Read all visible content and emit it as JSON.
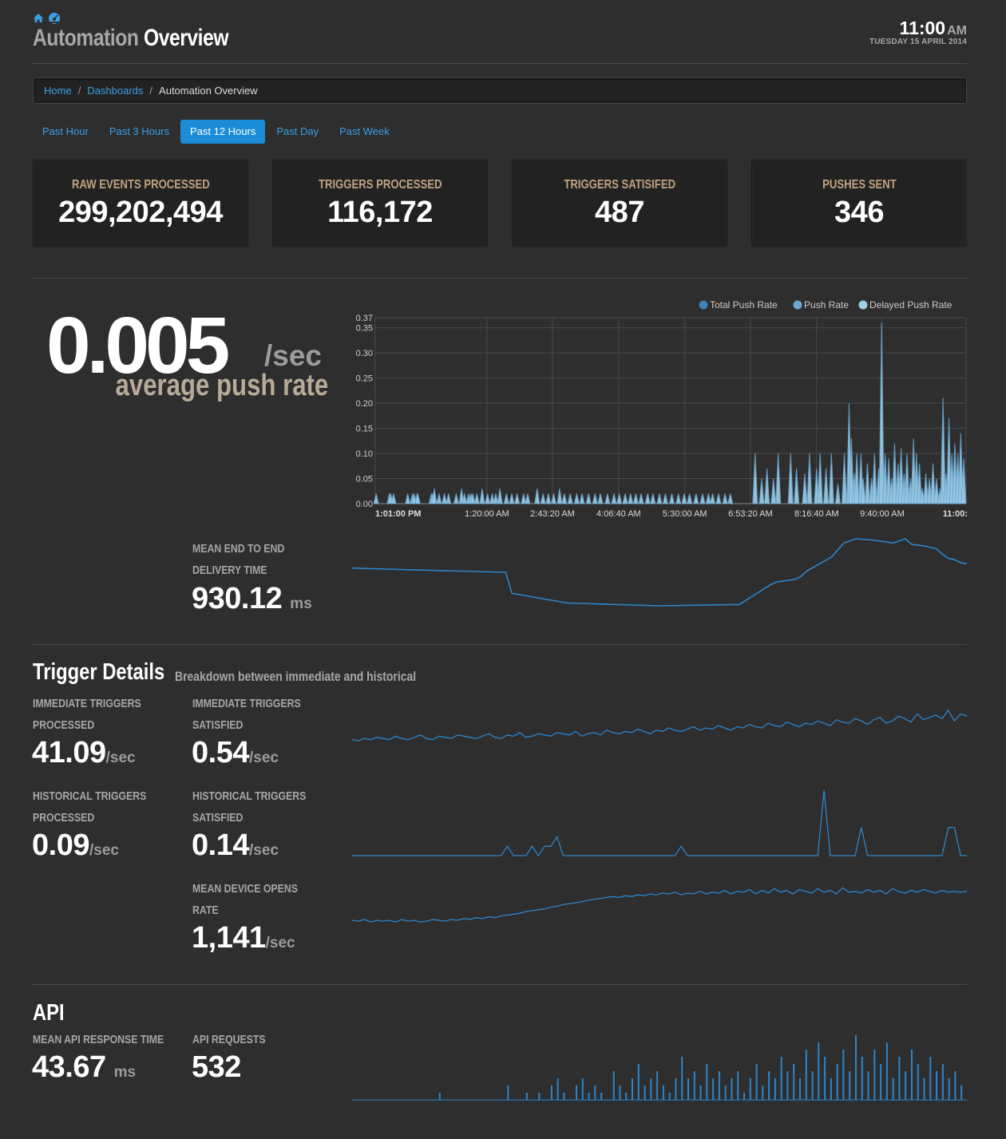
{
  "header": {
    "title_part1": "Automation",
    "title_part2": "Overview",
    "time": "11:00",
    "ampm": "AM",
    "date": "TUESDAY 15 APRIL 2014",
    "icons": [
      "home-icon",
      "dashboard-icon"
    ]
  },
  "breadcrumb": {
    "items": [
      "Home",
      "Dashboards"
    ],
    "current": "Automation Overview",
    "separator": "/"
  },
  "time_tabs": {
    "items": [
      "Past Hour",
      "Past 3 Hours",
      "Past 12 Hours",
      "Past Day",
      "Past Week"
    ],
    "active": "Past 12 Hours"
  },
  "stats": [
    {
      "label": "RAW EVENTS PROCESSED",
      "value": "299,202,494"
    },
    {
      "label": "TRIGGERS PROCESSED",
      "value": "116,172"
    },
    {
      "label": "TRIGGERS SATISIFED",
      "value": "487"
    },
    {
      "label": "PUSHES SENT",
      "value": "346"
    }
  ],
  "push_rate": {
    "value": "0.005",
    "unit": "/sec",
    "label": "average push rate"
  },
  "delivery": {
    "label_line1": "MEAN END TO END",
    "label_line2": "DELIVERY TIME",
    "value": "930.12",
    "unit": "ms"
  },
  "trigger_details": {
    "title": "Trigger Details",
    "subtitle": "Breakdown between immediate and historical",
    "metrics": [
      {
        "l1": "IMMEDIATE TRIGGERS",
        "l2": "PROCESSED",
        "value": "41.09",
        "unit": "/sec"
      },
      {
        "l1": "IMMEDIATE TRIGGERS",
        "l2": "SATISFIED",
        "value": "0.54",
        "unit": "/sec"
      },
      {
        "l1": "HISTORICAL TRIGGERS",
        "l2": "PROCESSED",
        "value": "0.09",
        "unit": "/sec"
      },
      {
        "l1": "HISTORICAL TRIGGERS",
        "l2": "SATISFIED",
        "value": "0.14",
        "unit": "/sec"
      },
      {
        "l1": "MEAN DEVICE OPENS",
        "l2": "RATE",
        "value": "1,141",
        "unit": "/sec"
      }
    ]
  },
  "api": {
    "title": "API",
    "response_label": "MEAN API RESPONSE TIME",
    "response_value": "43.67",
    "response_unit": "ms",
    "requests_label": "API REQUESTS",
    "requests_value": "532"
  },
  "colors": {
    "accent": "#1a8cd8",
    "link": "#3aa0e6",
    "stat_label": "#c3a27d",
    "series_total": "#3d82b8",
    "series_push": "#6aa8d4",
    "series_delayed": "#9fd0ea",
    "spark": "#2b86cc"
  },
  "chart_data": [
    {
      "type": "area",
      "title": "",
      "legend": "top-right",
      "grid": true,
      "series": [
        {
          "name": "Total Push Rate",
          "color": "#3d82b8"
        },
        {
          "name": "Push Rate",
          "color": "#6aa8d4"
        },
        {
          "name": "Delayed Push Rate",
          "color": "#9fd0ea"
        }
      ],
      "ylim": [
        0,
        0.37
      ],
      "y_ticks": [
        "0.00",
        "0.05",
        "0.10",
        "0.15",
        "0.20",
        "0.25",
        "0.30",
        "0.35",
        "0.37"
      ],
      "x_ticks": [
        "1:01:00 PM",
        "1:20:00 AM",
        "2:43:20 AM",
        "4:06:40 AM",
        "5:30:00 AM",
        "6:53:20 AM",
        "8:16:40 AM",
        "9:40:00 AM",
        "11:00:"
      ],
      "spikes": [
        [
          0.15,
          0.02
        ],
        [
          2.4,
          0.02
        ],
        [
          2.6,
          0.02
        ],
        [
          3.1,
          0.02
        ],
        [
          5.5,
          0.02
        ],
        [
          6.3,
          0.02
        ],
        [
          6.6,
          0.02
        ],
        [
          7.1,
          0.02
        ],
        [
          7.2,
          0.02
        ],
        [
          9.5,
          0.02
        ],
        [
          9.7,
          0.02
        ],
        [
          10.0,
          0.03
        ],
        [
          10.8,
          0.02
        ],
        [
          11.7,
          0.02
        ],
        [
          12.4,
          0.02
        ],
        [
          13.7,
          0.02
        ],
        [
          14.6,
          0.03
        ],
        [
          15.1,
          0.02
        ],
        [
          15.8,
          0.02
        ],
        [
          16.2,
          0.02
        ],
        [
          16.5,
          0.02
        ],
        [
          17.2,
          0.02
        ],
        [
          18.1,
          0.03
        ],
        [
          19.0,
          0.02
        ],
        [
          19.8,
          0.02
        ],
        [
          20.4,
          0.02
        ],
        [
          21.1,
          0.03
        ],
        [
          22.2,
          0.02
        ],
        [
          23.1,
          0.02
        ],
        [
          24.0,
          0.02
        ],
        [
          25.1,
          0.02
        ],
        [
          25.8,
          0.02
        ],
        [
          27.4,
          0.03
        ],
        [
          28.4,
          0.02
        ],
        [
          29.3,
          0.02
        ],
        [
          30.2,
          0.02
        ],
        [
          31.2,
          0.03
        ],
        [
          32.0,
          0.02
        ],
        [
          33.0,
          0.02
        ],
        [
          34.1,
          0.02
        ],
        [
          35.0,
          0.02
        ],
        [
          36.1,
          0.02
        ],
        [
          37.2,
          0.02
        ],
        [
          38.1,
          0.02
        ],
        [
          39.3,
          0.02
        ],
        [
          40.4,
          0.02
        ],
        [
          41.3,
          0.02
        ],
        [
          42.3,
          0.02
        ],
        [
          43.2,
          0.02
        ],
        [
          44.1,
          0.02
        ],
        [
          45.0,
          0.02
        ],
        [
          46.1,
          0.02
        ],
        [
          47.0,
          0.02
        ],
        [
          48.1,
          0.02
        ],
        [
          49.1,
          0.02
        ],
        [
          50.2,
          0.02
        ],
        [
          51.3,
          0.02
        ],
        [
          52.3,
          0.02
        ],
        [
          53.2,
          0.02
        ],
        [
          54.3,
          0.02
        ],
        [
          55.4,
          0.02
        ],
        [
          56.4,
          0.02
        ],
        [
          57.1,
          0.02
        ],
        [
          58.1,
          0.02
        ],
        [
          59.2,
          0.02
        ],
        [
          60.1,
          0.02
        ],
        [
          64.3,
          0.1
        ],
        [
          65.4,
          0.05
        ],
        [
          66.3,
          0.07
        ],
        [
          67.4,
          0.05
        ],
        [
          68.2,
          0.1
        ],
        [
          70.3,
          0.1
        ],
        [
          71.3,
          0.07
        ],
        [
          72.7,
          0.06
        ],
        [
          73.5,
          0.1
        ],
        [
          74.7,
          0.07
        ],
        [
          75.3,
          0.1
        ],
        [
          76.3,
          0.07
        ],
        [
          77.2,
          0.1
        ],
        [
          78.3,
          0.04
        ],
        [
          79.4,
          0.1
        ],
        [
          80.2,
          0.2
        ],
        [
          80.6,
          0.13
        ],
        [
          81.1,
          0.06
        ],
        [
          81.5,
          0.1
        ],
        [
          82.2,
          0.1
        ],
        [
          82.6,
          0.05
        ],
        [
          83.3,
          0.08
        ],
        [
          84.0,
          0.05
        ],
        [
          84.5,
          0.1
        ],
        [
          85.2,
          0.07
        ],
        [
          85.7,
          0.36
        ],
        [
          86.3,
          0.1
        ],
        [
          86.9,
          0.09
        ],
        [
          87.4,
          0.05
        ],
        [
          87.9,
          0.12
        ],
        [
          88.5,
          0.08
        ],
        [
          89.0,
          0.11
        ],
        [
          89.5,
          0.06
        ],
        [
          90.0,
          0.1
        ],
        [
          90.6,
          0.05
        ],
        [
          91.1,
          0.13
        ],
        [
          91.6,
          0.1
        ],
        [
          92.1,
          0.08
        ],
        [
          92.6,
          0.03
        ],
        [
          93.2,
          0.06
        ],
        [
          93.8,
          0.05
        ],
        [
          94.4,
          0.08
        ],
        [
          95.0,
          0.05
        ],
        [
          95.6,
          0.03
        ],
        [
          96.1,
          0.21
        ],
        [
          96.6,
          0.06
        ],
        [
          97.1,
          0.17
        ],
        [
          97.6,
          0.1
        ],
        [
          98.1,
          0.12
        ],
        [
          98.6,
          0.1
        ],
        [
          99.1,
          0.14
        ],
        [
          99.6,
          0.09
        ]
      ]
    },
    {
      "type": "line",
      "title": "",
      "x": [
        0,
        8,
        25,
        26,
        35,
        50,
        63,
        68,
        69,
        72,
        73,
        74,
        78,
        80,
        82,
        85,
        88,
        90,
        91,
        93,
        95,
        96,
        97,
        98,
        99,
        100
      ],
      "values": [
        930,
        929,
        927,
        912,
        905,
        903,
        904,
        918,
        920,
        922,
        924,
        928,
        938,
        948,
        951,
        950,
        948,
        951,
        947,
        946,
        944,
        940,
        937,
        936,
        934,
        933
      ]
    },
    {
      "type": "line",
      "title": "",
      "values": [
        30,
        29,
        31,
        30,
        32,
        31,
        30,
        33,
        31,
        30,
        32,
        34,
        31,
        30,
        33,
        32,
        31,
        34,
        33,
        32,
        31,
        33,
        35,
        32,
        31,
        34,
        33,
        36,
        32,
        33,
        35,
        34,
        33,
        36,
        35,
        34,
        37,
        33,
        35,
        36,
        34,
        38,
        36,
        35,
        37,
        36,
        39,
        37,
        35,
        38,
        37,
        40,
        38,
        37,
        39,
        41,
        38,
        40,
        39,
        42,
        40,
        38,
        41,
        40,
        43,
        41,
        40,
        44,
        42,
        41,
        45,
        43,
        41,
        44,
        43,
        46,
        44,
        42,
        47,
        45,
        44,
        48,
        46,
        43,
        47,
        49,
        44,
        46,
        50,
        48,
        45,
        52,
        47,
        49,
        51,
        48,
        55,
        46,
        52,
        50
      ]
    },
    {
      "type": "line",
      "title": "",
      "values": [
        0,
        0,
        0,
        0,
        0,
        0,
        0,
        0,
        0,
        0,
        0,
        0,
        0,
        0,
        0,
        0,
        0,
        0,
        0,
        0,
        0,
        0,
        0,
        0,
        0,
        1,
        0,
        0,
        0,
        1,
        0,
        1,
        1,
        2,
        0,
        0,
        0,
        0,
        0,
        0,
        0,
        0,
        0,
        0,
        0,
        0,
        0,
        0,
        0,
        0,
        0,
        0,
        0,
        1,
        0,
        0,
        0,
        0,
        0,
        0,
        0,
        0,
        0,
        0,
        0,
        0,
        0,
        0,
        0,
        0,
        0,
        0,
        0,
        0,
        0,
        0,
        7,
        0,
        0,
        0,
        0,
        0,
        3,
        0,
        0,
        0,
        0,
        0,
        0,
        0,
        0,
        0,
        0,
        0,
        0,
        0,
        3,
        3,
        0,
        0
      ]
    },
    {
      "type": "line",
      "title": "",
      "values": [
        40,
        39,
        41,
        38,
        40,
        39,
        40,
        38,
        41,
        39,
        40,
        38,
        39,
        41,
        40,
        39,
        41,
        40,
        42,
        41,
        43,
        42,
        44,
        43,
        45,
        46,
        47,
        48,
        50,
        51,
        52,
        53,
        55,
        56,
        58,
        59,
        60,
        61,
        63,
        64,
        65,
        66,
        67,
        66,
        68,
        67,
        69,
        68,
        70,
        69,
        71,
        70,
        72,
        69,
        71,
        70,
        73,
        70,
        72,
        71,
        74,
        70,
        73,
        72,
        75,
        70,
        74,
        71,
        76,
        72,
        74,
        70,
        75,
        73,
        71,
        76,
        72,
        74,
        70,
        77,
        72,
        73,
        71,
        75,
        72,
        74,
        70,
        76,
        73,
        71,
        74,
        72,
        75,
        73,
        71,
        74,
        72,
        73,
        72,
        73
      ]
    },
    {
      "type": "bar",
      "title": "",
      "values": [
        0,
        0,
        0,
        0,
        0,
        0,
        0,
        0,
        0,
        0,
        0,
        0,
        0,
        0,
        1,
        0,
        0,
        0,
        0,
        0,
        0,
        0,
        0,
        0,
        0,
        2,
        0,
        0,
        1,
        0,
        1,
        0,
        2,
        3,
        1,
        0,
        2,
        3,
        1,
        2,
        1,
        0,
        4,
        2,
        1,
        3,
        5,
        2,
        3,
        4,
        2,
        1,
        3,
        6,
        3,
        4,
        2,
        5,
        3,
        4,
        2,
        3,
        4,
        1,
        3,
        5,
        2,
        4,
        3,
        6,
        4,
        5,
        3,
        7,
        4,
        8,
        6,
        3,
        5,
        7,
        4,
        9,
        6,
        4,
        7,
        5,
        8,
        3,
        6,
        4,
        7,
        5,
        3,
        6,
        4,
        5,
        3,
        4,
        2,
        3
      ]
    }
  ]
}
